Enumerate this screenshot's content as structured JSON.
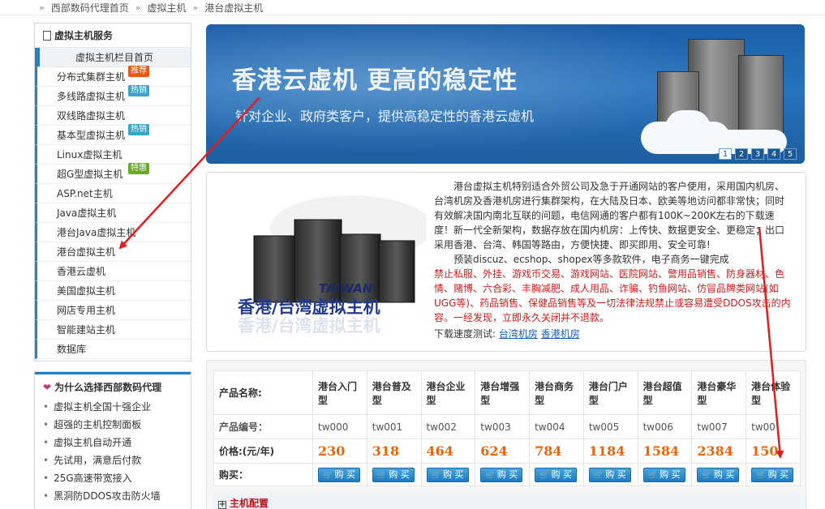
{
  "breadcrumb": [
    "西部数码代理首页",
    "虚拟主机",
    "港台虚拟主机"
  ],
  "sidebar": {
    "title": "虚拟主机服务",
    "items": [
      {
        "label": "虚拟主机栏目首页",
        "tag": ""
      },
      {
        "label": "分布式集群主机",
        "tag": "推荐"
      },
      {
        "label": "多线路虚拟主机",
        "tag": "热销"
      },
      {
        "label": "双线路虚拟主机",
        "tag": ""
      },
      {
        "label": "基本型虚拟主机",
        "tag": "热销"
      },
      {
        "label": "Linux虚拟主机",
        "tag": ""
      },
      {
        "label": "超G型虚拟主机",
        "tag": "特惠"
      },
      {
        "label": "ASP.net主机",
        "tag": ""
      },
      {
        "label": "Java虚拟主机",
        "tag": ""
      },
      {
        "label": "港台Java虚拟主机",
        "tag": ""
      },
      {
        "label": "港台虚拟主机",
        "tag": ""
      },
      {
        "label": "香港云虚机",
        "tag": ""
      },
      {
        "label": "美国虚拟主机",
        "tag": ""
      },
      {
        "label": "网店专用主机",
        "tag": ""
      },
      {
        "label": "智能建站主机",
        "tag": ""
      },
      {
        "label": "数据库",
        "tag": ""
      }
    ]
  },
  "why": {
    "title": "为什么选择西部数码代理",
    "items": [
      "虚拟主机全国十强企业",
      "超强的主机控制面板",
      "虚拟主机自动开通",
      "先试用，满意后付款",
      "25G高速带宽接入",
      "黑洞防DDOS攻击防火墙"
    ]
  },
  "banner": {
    "title": "香港云虚机 更高的稳定性",
    "subtitle": "针对企业、政府类客户，提供高稳定性的香港云虚机",
    "slides": [
      "1",
      "2",
      "3",
      "4",
      "5"
    ]
  },
  "info": {
    "image_caption_en": "TAIWAN",
    "image_caption_cn": "香港/台湾虚拟主机",
    "p1": "　　港台虚拟主机特别适合外贸公司及急于开通网站的客户使用，采用国内机房、台湾机房及香港机房进行集群架构，在大陆及日本、欧美等地访问都非常快；同时有效解决国内南北互联的问题，电信网通的客户都有100K~200K左右的下载速度！新一代全新架构，数据存放在国内机房：上传快、数据更安全、更稳定；出口采用香港、台湾、韩国等路由，方便快捷、即买即用、安全可靠!",
    "p2": "　　预装discuz、ecshop、shopex等多款软件，电子商务一键完成",
    "warn": "禁止私服、外挂、游戏币交易、游戏网站、医院网站、警用品销售、防身器材、色情、赌博、六合彩、丰胸减肥、成人用品、诈骗、钓鱼网站、仿冒品牌类网站(如UGG等)、药品销售、保健品销售等及一切法律法规禁止或容易遭受DDOS攻击的内容。一经发现，立即永久关闭并不退款。",
    "speed_label": "下载速度测试:",
    "speed_links": [
      "台湾机房",
      "香港机房"
    ]
  },
  "table": {
    "labels": {
      "name": "产品名称:",
      "id": "产品编号：",
      "price": "价格:(元/年)",
      "buy": "购买："
    },
    "buy_label": "购 买",
    "products": [
      {
        "name": "港台入门型",
        "id": "tw000",
        "price": "230"
      },
      {
        "name": "港台普及型",
        "id": "tw001",
        "price": "318"
      },
      {
        "name": "港台企业型",
        "id": "tw002",
        "price": "464"
      },
      {
        "name": "港台增强型",
        "id": "tw003",
        "price": "624"
      },
      {
        "name": "港台商务型",
        "id": "tw004",
        "price": "784"
      },
      {
        "name": "港台门户型",
        "id": "tw005",
        "price": "1184"
      },
      {
        "name": "港台超值型",
        "id": "tw006",
        "price": "1584"
      },
      {
        "name": "港台豪华型",
        "id": "tw007",
        "price": "2384"
      },
      {
        "name": "港台体验型",
        "id": "tw00",
        "price": "150"
      }
    ],
    "config_label": "主机配置"
  },
  "colors": {
    "accent": "#2a7fc1",
    "price": "#e8650a",
    "warn": "#d41a1a",
    "arrow": "#e31c1c"
  }
}
